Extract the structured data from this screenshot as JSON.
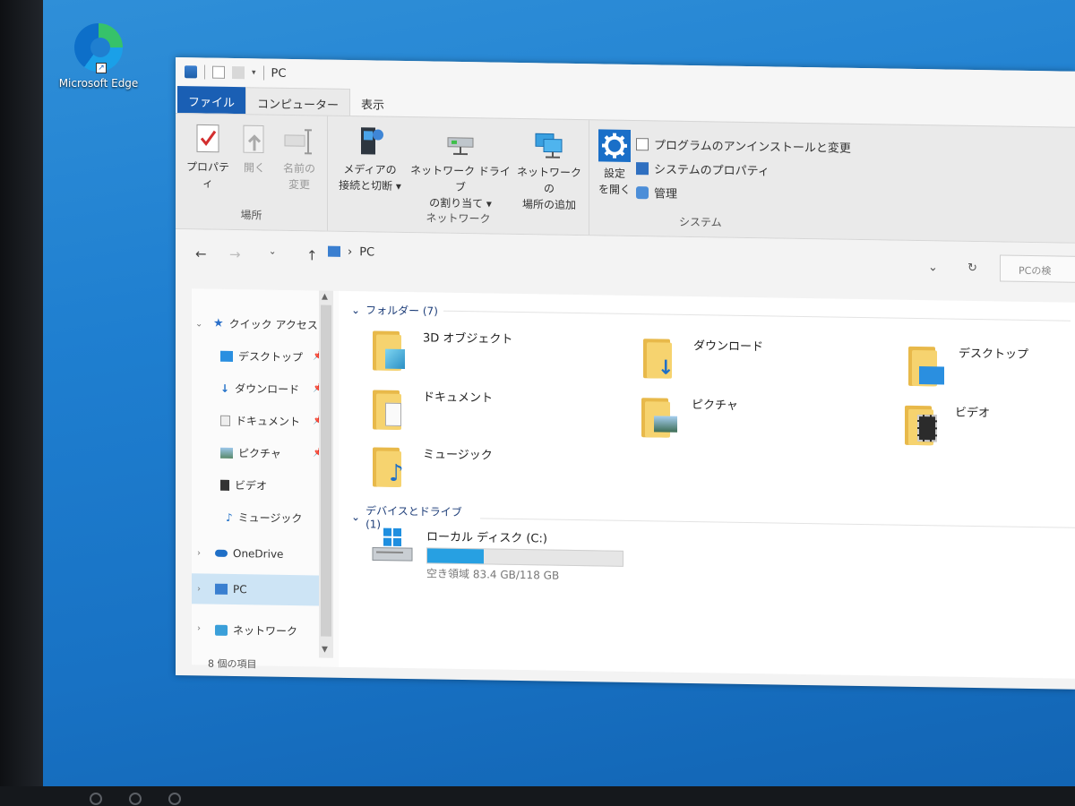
{
  "desktop": {
    "edge_label": "Microsoft Edge"
  },
  "window": {
    "title": "PC",
    "tabs": {
      "file": "ファイル",
      "computer": "コンピューター",
      "view": "表示"
    },
    "ribbon": {
      "location": {
        "label": "場所",
        "properties": "プロパティ",
        "open": "開く",
        "rename_1": "名前の",
        "rename_2": "変更"
      },
      "network": {
        "label": "ネットワーク",
        "media_1": "メディアの",
        "media_2": "接続と切断 ▾",
        "map_1": "ネットワーク ドライブ",
        "map_2": "の割り当て ▾",
        "add_1": "ネットワークの",
        "add_2": "場所の追加"
      },
      "system": {
        "label": "システム",
        "settings_1": "設定",
        "settings_2": "を開く",
        "uninstall": "プログラムのアンインストールと変更",
        "sysprops": "システムのプロパティ",
        "manage": "管理"
      }
    },
    "address": {
      "path": "PC",
      "search_placeholder": "PCの検"
    },
    "nav": {
      "quick_access": "クイック アクセス",
      "desktop": "デスクトップ",
      "downloads": "ダウンロード",
      "documents": "ドキュメント",
      "pictures": "ピクチャ",
      "videos": "ビデオ",
      "music": "ミュージック",
      "onedrive": "OneDrive",
      "pc": "PC",
      "network": "ネットワーク"
    },
    "content": {
      "folders_header": "フォルダー (7)",
      "folders": {
        "objects3d": "3D オブジェクト",
        "downloads": "ダウンロード",
        "desktop": "デスクトップ",
        "documents": "ドキュメント",
        "pictures": "ピクチャ",
        "videos": "ビデオ",
        "music": "ミュージック"
      },
      "devices_header": "デバイスとドライブ (1)",
      "drive": {
        "name": "ローカル ディスク (C:)",
        "free_text": "空き領域 83.4 GB/118 GB",
        "used_fraction": 0.29
      }
    },
    "status": "8 個の項目"
  },
  "colors": {
    "file_tab": "#1a5fb4",
    "selection": "#cde4f5",
    "drive_bar": "#27a0e2"
  }
}
